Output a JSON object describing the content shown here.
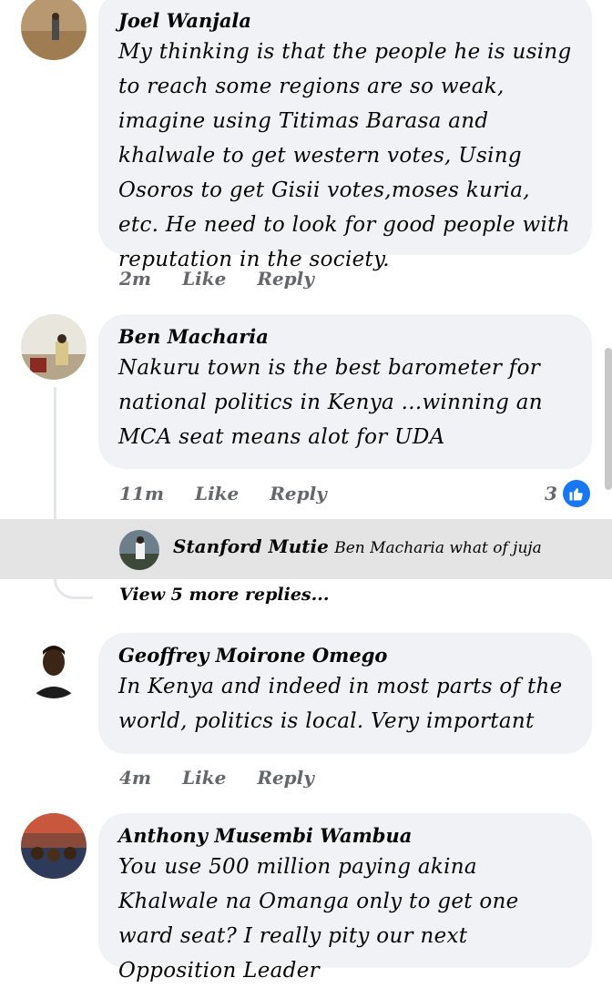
{
  "comments": [
    {
      "author": "Joel Wanjala",
      "text": "My thinking is that the people he is using to reach some regions are so weak, imagine using Titimas Barasa and khalwale to get western votes, Using  Osoros to get Gisii votes,moses kuria, etc. He need to look for good people with reputation in the society.",
      "time": "2m",
      "like": "Like",
      "reply": "Reply"
    },
    {
      "author": "Ben Macharia",
      "text": "Nakuru  town is the best barometer for national politics in Kenya ...winning an MCA seat means alot for UDA",
      "time": "11m",
      "like": "Like",
      "reply": "Reply",
      "reaction_count": "3"
    },
    {
      "author": "Geoffrey Moirone Omego",
      "text": "In Kenya and indeed  in most parts of the world, politics is local. Very important",
      "time": "4m",
      "like": "Like",
      "reply": "Reply"
    },
    {
      "author": "Anthony Musembi Wambua",
      "text": "You use 500 million paying akina Khalwale na Omanga only to get one ward seat? I really pity our next Opposition Leader"
    }
  ],
  "reply": {
    "author": "Stanford Mutie",
    "text": "Ben Macharia what of juja"
  },
  "view_more": "View 5 more replies...",
  "icons": {
    "like_reaction": "thumbs-up-icon"
  },
  "colors": {
    "bubble": "#f0f2f5",
    "like_blue": "#1877f2",
    "meta_gray": "#65676b"
  }
}
